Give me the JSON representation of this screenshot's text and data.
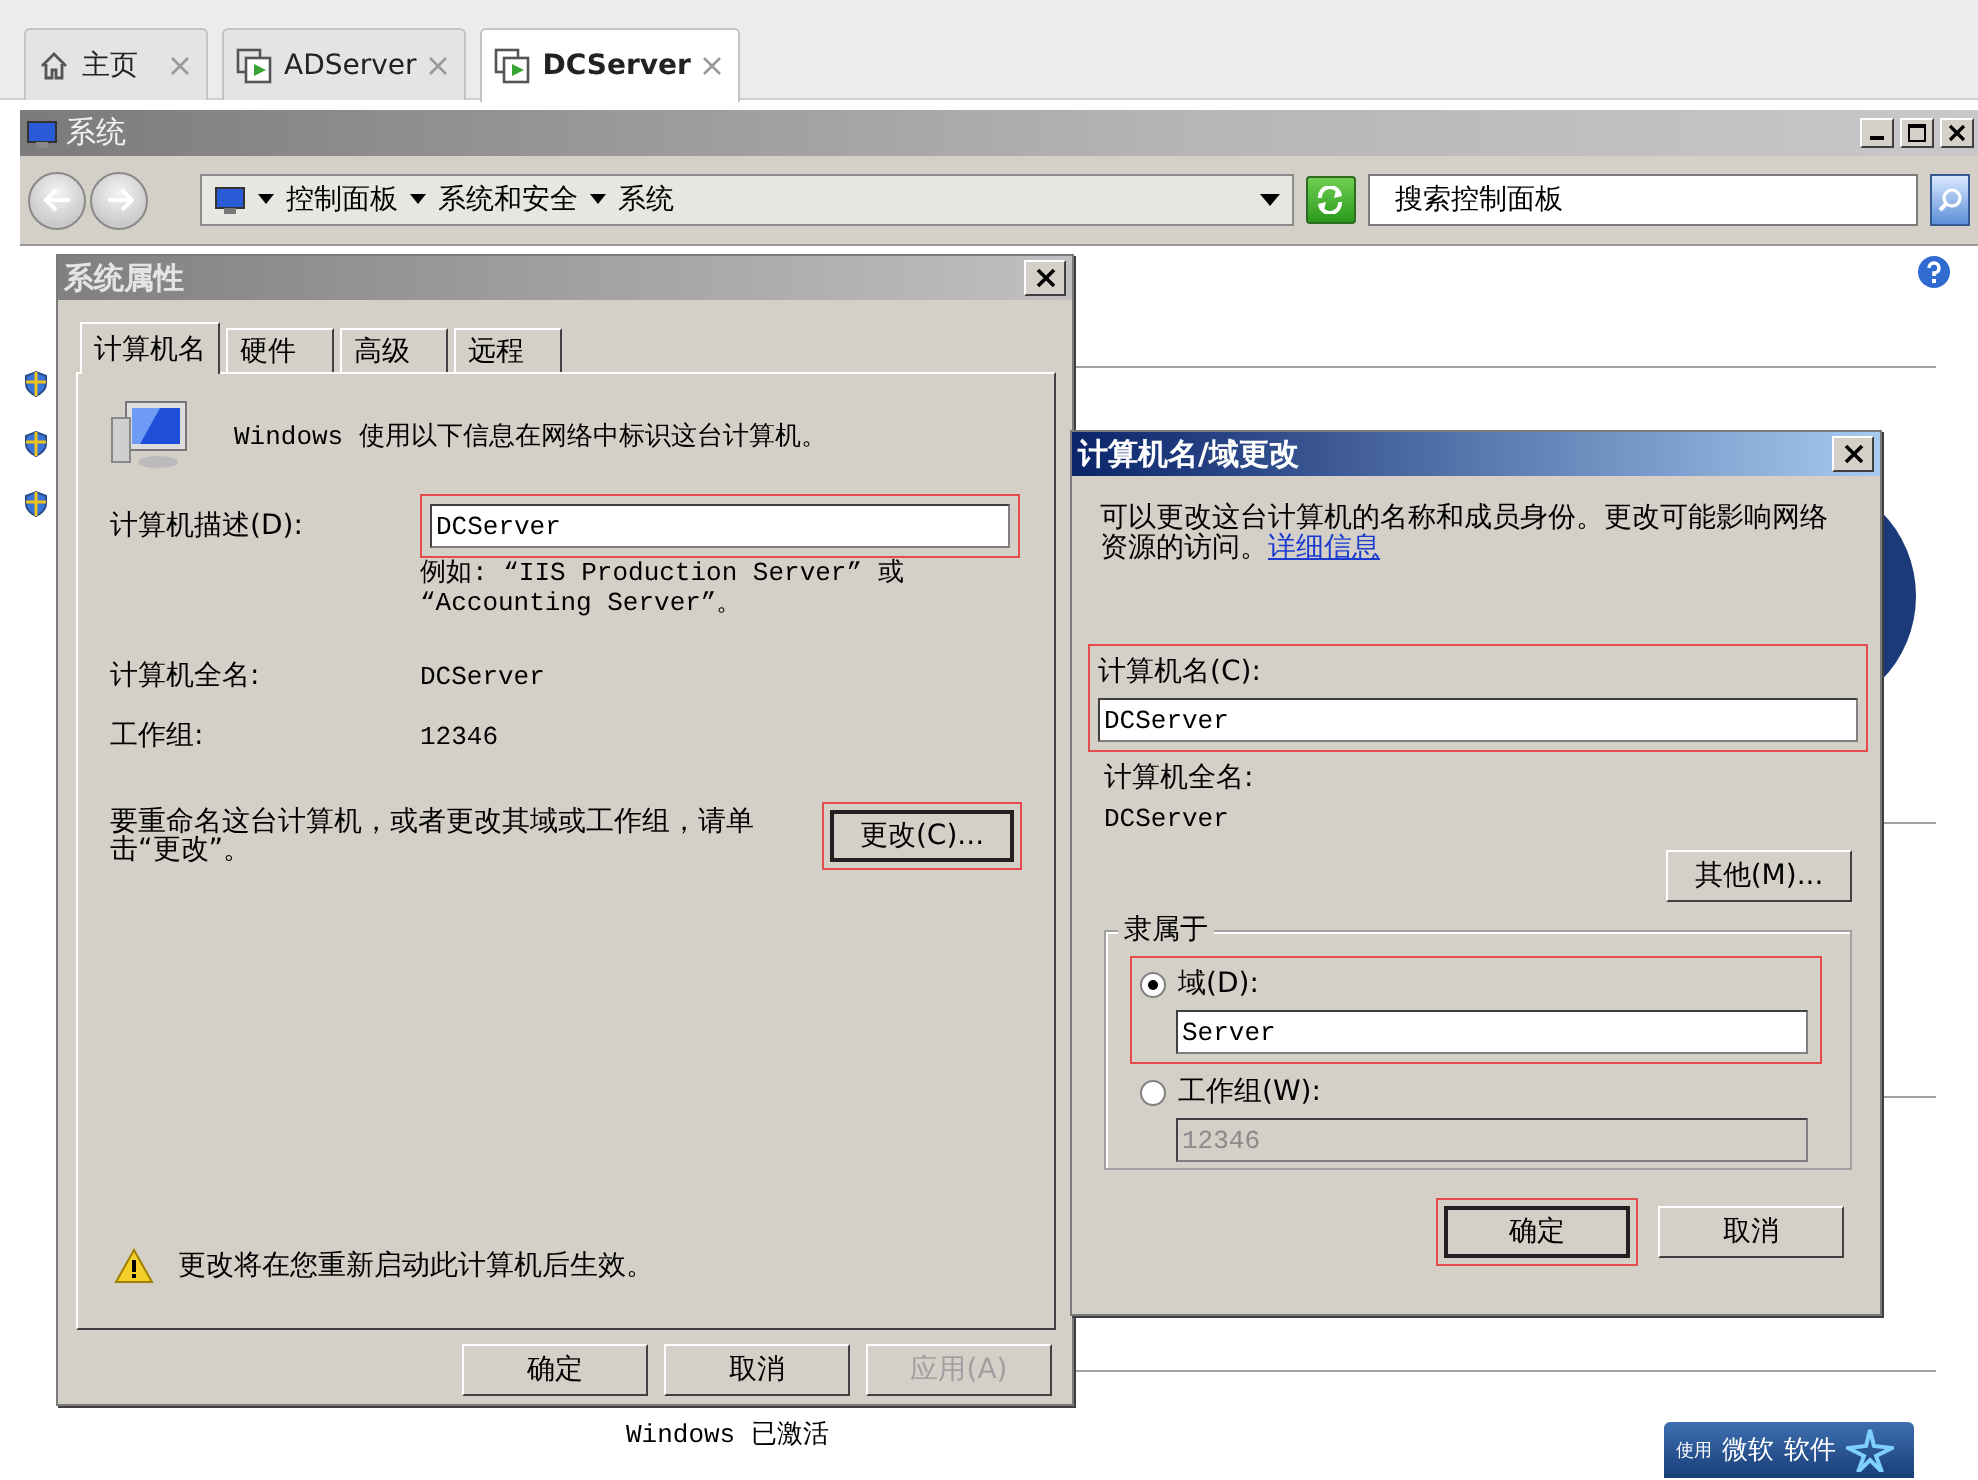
{
  "browser_tabs": [
    {
      "label": "主页",
      "kind": "home",
      "selected": false
    },
    {
      "label": "ADServer",
      "kind": "vm",
      "selected": false
    },
    {
      "label": "DCServer",
      "kind": "vm",
      "selected": true
    }
  ],
  "window": {
    "title": "系统"
  },
  "address_bar": {
    "segments": [
      "控制面板",
      "系统和安全",
      "系统"
    ]
  },
  "search": {
    "placeholder": "搜索控制面板"
  },
  "background": {
    "status_text": "Windows 已激活",
    "badge_texts": [
      "使用",
      "微软",
      "软件"
    ]
  },
  "system_properties": {
    "title": "系统属性",
    "tabs": [
      {
        "label": "计算机名",
        "selected": true
      },
      {
        "label": "硬件",
        "selected": false
      },
      {
        "label": "高级",
        "selected": false
      },
      {
        "label": "远程",
        "selected": false
      }
    ],
    "intro": "Windows 使用以下信息在网络中标识这台计算机。",
    "description": {
      "label": "计算机描述(D):",
      "value": "DCServer",
      "highlighted": true
    },
    "example": "例如: “IIS Production Server” 或 “Accounting Server”。",
    "info_rows": [
      {
        "label": "计算机全名:",
        "value": "DCServer"
      },
      {
        "label": "工作组:",
        "value": "12346"
      }
    ],
    "rename_text": "要重命名这台计算机，或者更改其域或工作组，请单击“更改”。",
    "change_button": {
      "label": "更改(C)...",
      "highlighted": true
    },
    "warning": "更改将在您重新启动此计算机后生效。",
    "buttons": [
      {
        "label": "确定",
        "disabled": false
      },
      {
        "label": "取消",
        "disabled": false
      },
      {
        "label": "应用(A)",
        "disabled": true
      }
    ]
  },
  "rename_dialog": {
    "title": "计算机名/域更改",
    "intro": "可以更改这台计算机的名称和成员身份。更改可能影响网络资源的访问。",
    "link": "详细信息",
    "name_field": {
      "label": "计算机名(C):",
      "value": "DCServer",
      "highlighted": true
    },
    "full_name": {
      "label": "计算机全名:",
      "value": "DCServer"
    },
    "more_button": "其他(M)...",
    "member_of": {
      "legend": "隶属于",
      "options": [
        {
          "label": "域(D):",
          "value": "Server",
          "selected": true,
          "highlighted": true
        },
        {
          "label": "工作组(W):",
          "value": "12346",
          "selected": false,
          "highlighted": false
        }
      ]
    },
    "buttons": [
      {
        "label": "确定",
        "highlighted": true
      },
      {
        "label": "取消",
        "highlighted": false
      }
    ]
  }
}
